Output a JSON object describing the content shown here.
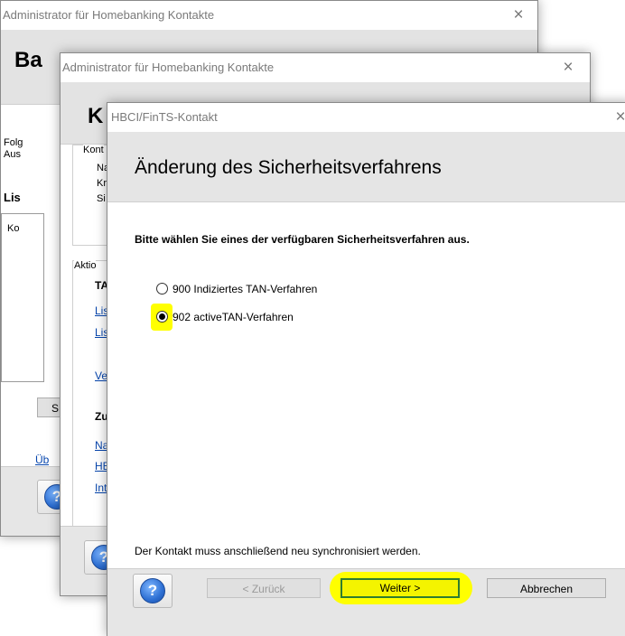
{
  "windows": {
    "back": {
      "title": "Administrator für Homebanking Kontakte",
      "close_glyph": "×",
      "header_fragment": "Ba",
      "text_fragments": [
        "Folg",
        "Aus",
        "Lis",
        "Ko"
      ],
      "button_fragment": "S",
      "link_fragment": "Üb"
    },
    "middle": {
      "title": "Administrator für Homebanking Kontakte",
      "close_glyph": "×",
      "header_fragment": "K",
      "group_kontakt_label": "Kont",
      "kontakt_fragments": [
        "Na",
        "Kr",
        "Si"
      ],
      "group_aktion_label": "Aktio",
      "section1_fragment": "TA",
      "links1": [
        "Lis",
        "Lis",
        "Ve"
      ],
      "section2_fragment": "Zu",
      "links2": [
        "Na",
        "HE",
        "Int"
      ]
    },
    "front": {
      "title": "HBCI/FinTS-Kontakt",
      "close_glyph": "×",
      "heading": "Änderung des Sicherheitsverfahrens",
      "instruction": "Bitte wählen Sie eines der verfügbaren Sicherheitsverfahren aus.",
      "options": [
        {
          "label": "900 Indiziertes TAN-Verfahren",
          "selected": false
        },
        {
          "label": "902 activeTAN-Verfahren",
          "selected": true
        }
      ],
      "footer_note": "Der Kontakt muss anschließend neu synchronisiert werden.",
      "buttons": {
        "back": "< Zurück",
        "next": "Weiter >",
        "cancel": "Abbrechen"
      },
      "help_glyph": "?"
    }
  },
  "colors": {
    "highlight": "#ffff00",
    "default_button_border": "#2f7d2f",
    "help_blue": "#2d6fd3"
  },
  "icons": {
    "help": "help-icon",
    "close": "close-icon"
  }
}
